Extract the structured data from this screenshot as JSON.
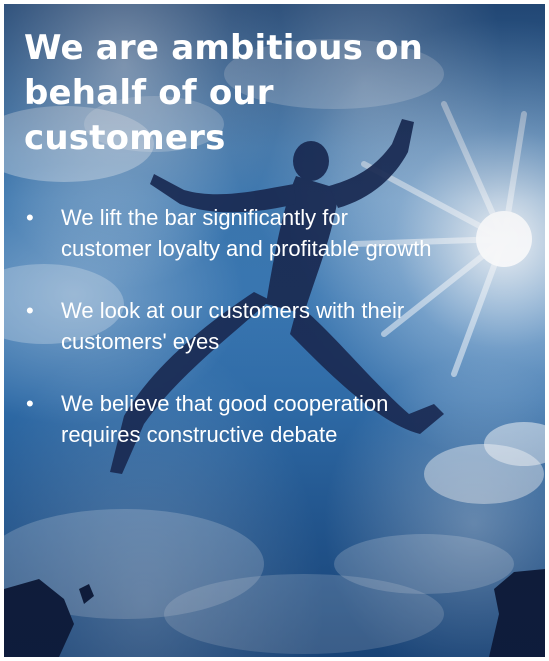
{
  "slide": {
    "title": "We are ambitious on behalf of our customers",
    "bullet_symbol": "•",
    "bullets": [
      "We lift the bar significantly for customer loyalty and profitable growth",
      "We look at our customers with their customers' eyes",
      "We believe that good cooperation requires constructive debate"
    ]
  },
  "background": {
    "image_subject": "jumping-person-silhouette",
    "sun": "sun-glow",
    "clouds": "cloud-shapes",
    "cliffs": "rock-cliffs"
  },
  "colors": {
    "text": "#ffffff",
    "sky_top": "#2f5d8d",
    "sky_bottom": "#1d4f86",
    "silhouette": "#1a2a52"
  }
}
